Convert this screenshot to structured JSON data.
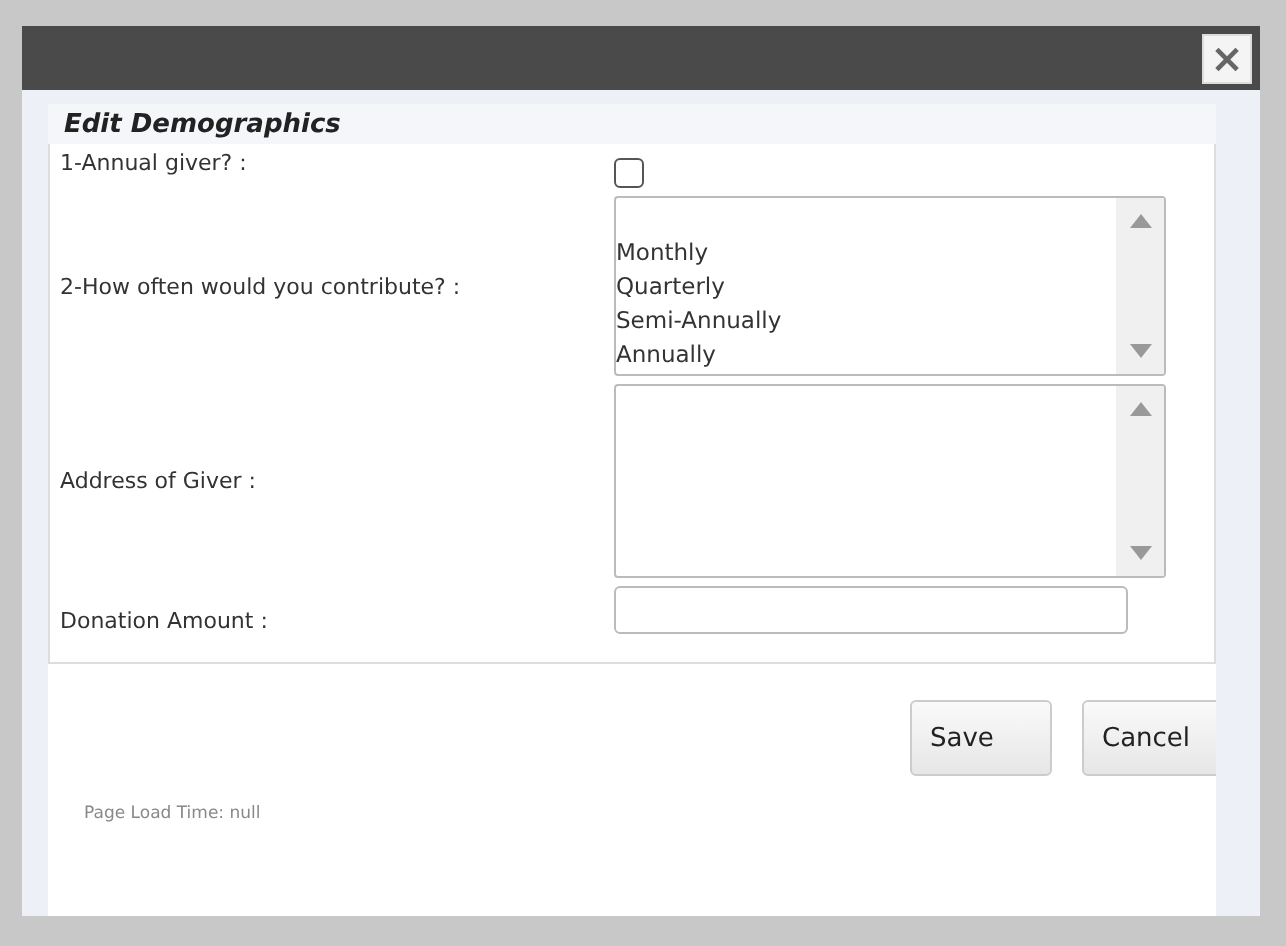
{
  "dialog": {
    "close_label": "×"
  },
  "form": {
    "title": "Edit Demographics",
    "fields": [
      {
        "kind": "checkbox",
        "label": "1-Annual giver? :",
        "checked": false
      },
      {
        "kind": "listbox",
        "label": "2-How often would you contribute? :",
        "options": [
          "Monthly",
          "Quarterly",
          "Semi-Annually",
          "Annually"
        ]
      },
      {
        "kind": "textarea",
        "label": "Address of Giver :"
      },
      {
        "kind": "text",
        "label": "Donation Amount :"
      }
    ]
  },
  "buttons": [
    "Save",
    "Cancel"
  ],
  "footer": "Page Load Time: null"
}
